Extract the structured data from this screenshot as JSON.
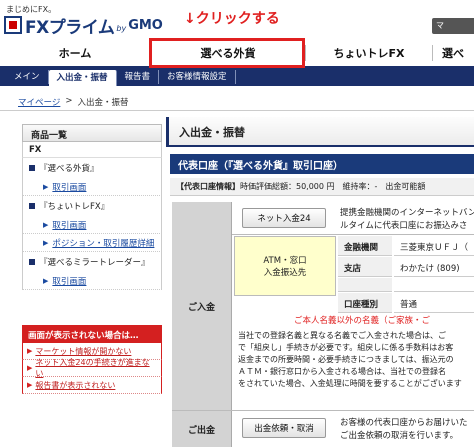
{
  "header": {
    "tagline": "まじめにFX。",
    "logo_fx": "FXプライム",
    "logo_by": "by",
    "logo_gmo": "GMO",
    "annotation": "↓クリックする",
    "corner_button": "マ"
  },
  "main_nav": [
    "ホーム",
    "選べる外貨",
    "ちょいトレFX",
    "選べ"
  ],
  "sub_nav": [
    "メイン",
    "入出金・振替",
    "報告書",
    "お客様情報設定"
  ],
  "breadcrumb": {
    "home": "マイページ",
    "sep": ">",
    "current": "入出金・振替"
  },
  "sidebar": {
    "header": "商品一覧",
    "category": "FX",
    "products": [
      {
        "name": "『選べる外貨』",
        "links": [
          "取引画面"
        ]
      },
      {
        "name": "『ちょいトレFX』",
        "links": [
          "取引画面",
          "ポジション・取引履歴詳細"
        ]
      },
      {
        "name": "『選べるミラートレーダー』",
        "links": [
          "取引画面"
        ]
      }
    ]
  },
  "alert": {
    "header": "画面が表示されない場合は…",
    "items": [
      "マーケット情報が開かない",
      "ネット入金24の手続きが進まない",
      "報告書が表示されない"
    ]
  },
  "content": {
    "title": "入出金・振替",
    "section": "代表口座（『選べる外貨』取引口座）",
    "info_label": "【代表口座情報】",
    "info_text": "時価評価総額：50,000 円　維持率：-　出金可能額",
    "deposit_label": "ご入金",
    "withdraw_label": "ご出金",
    "net_deposit_button": "ネット入金24",
    "net_deposit_desc_1": "提携金融機関のインターネットバン",
    "net_deposit_desc_2": "ルタイムに代表口座にお振込みさ",
    "atm_line1": "ATM・窓口",
    "atm_line2": "入金振込先",
    "bank": [
      {
        "label": "金融機関",
        "value": "三菱東京ＵＦＪ（"
      },
      {
        "label": "支店",
        "value": "わかたけ (809)"
      },
      {
        "label": "",
        "value": ""
      },
      {
        "label": "口座種別",
        "value": "普通"
      }
    ],
    "warning": "ご本人名義以外の名義（ご家族・ご",
    "paragraph": [
      "当社での登録名義と異なる名義でご入金された場合は、ご",
      "で「組戻し」手続きが必要です。組戻しに係る手数料はお客",
      "返金までの所要時間・必要手続きにつきましては、振込元の",
      "ＡＴＭ・銀行窓口から入金される場合は、当社での登録名",
      "をされていた場合、入金処理に時間を要することがございます"
    ],
    "withdraw_button": "出金依頼・取消",
    "withdraw_desc_1": "お客様の代表口座からお届けいた",
    "withdraw_desc_2": "ご出金依頼の取消を行います。"
  }
}
